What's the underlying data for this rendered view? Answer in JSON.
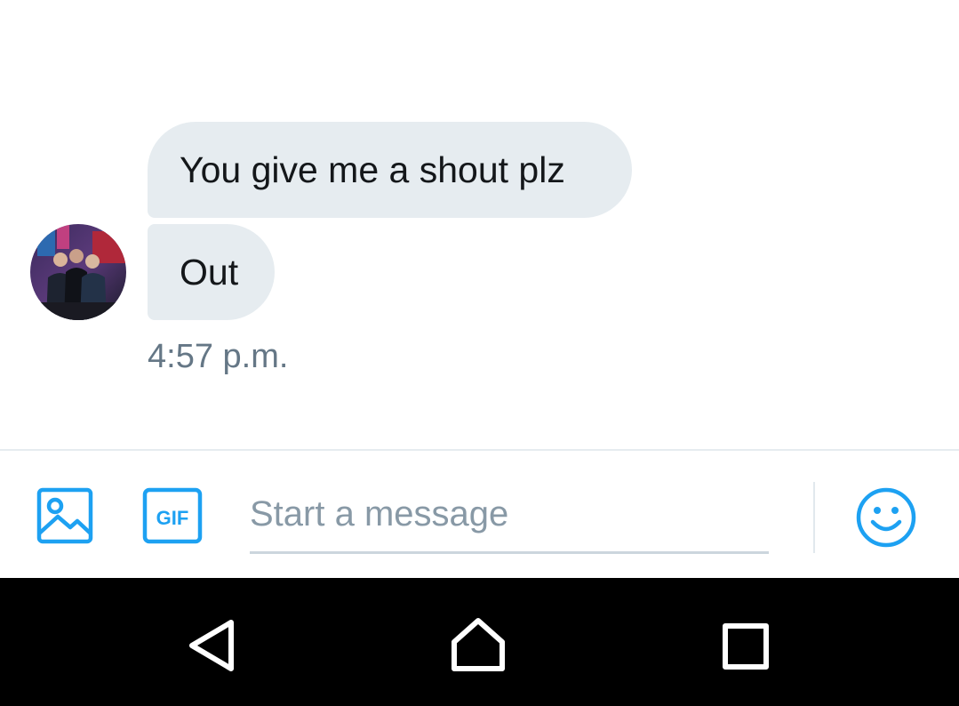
{
  "conversation": {
    "messages": [
      {
        "text": "You give me a shout plz"
      },
      {
        "text": "Out"
      }
    ],
    "timestamp": "4:57 p.m."
  },
  "composer": {
    "placeholder": "Start a message",
    "gif_label": "GIF",
    "icons": {
      "photo": "image-icon",
      "gif": "gif-icon",
      "emoji": "smiley-icon"
    },
    "accent_color": "#1da1f2"
  },
  "navbar": {
    "icons": [
      "back-triangle-icon",
      "home-icon",
      "recents-square-icon"
    ]
  },
  "colors": {
    "bubble_background": "#e6ecf0",
    "text_primary": "#14171a",
    "text_secondary": "#657786",
    "navbar_background": "#000000"
  }
}
